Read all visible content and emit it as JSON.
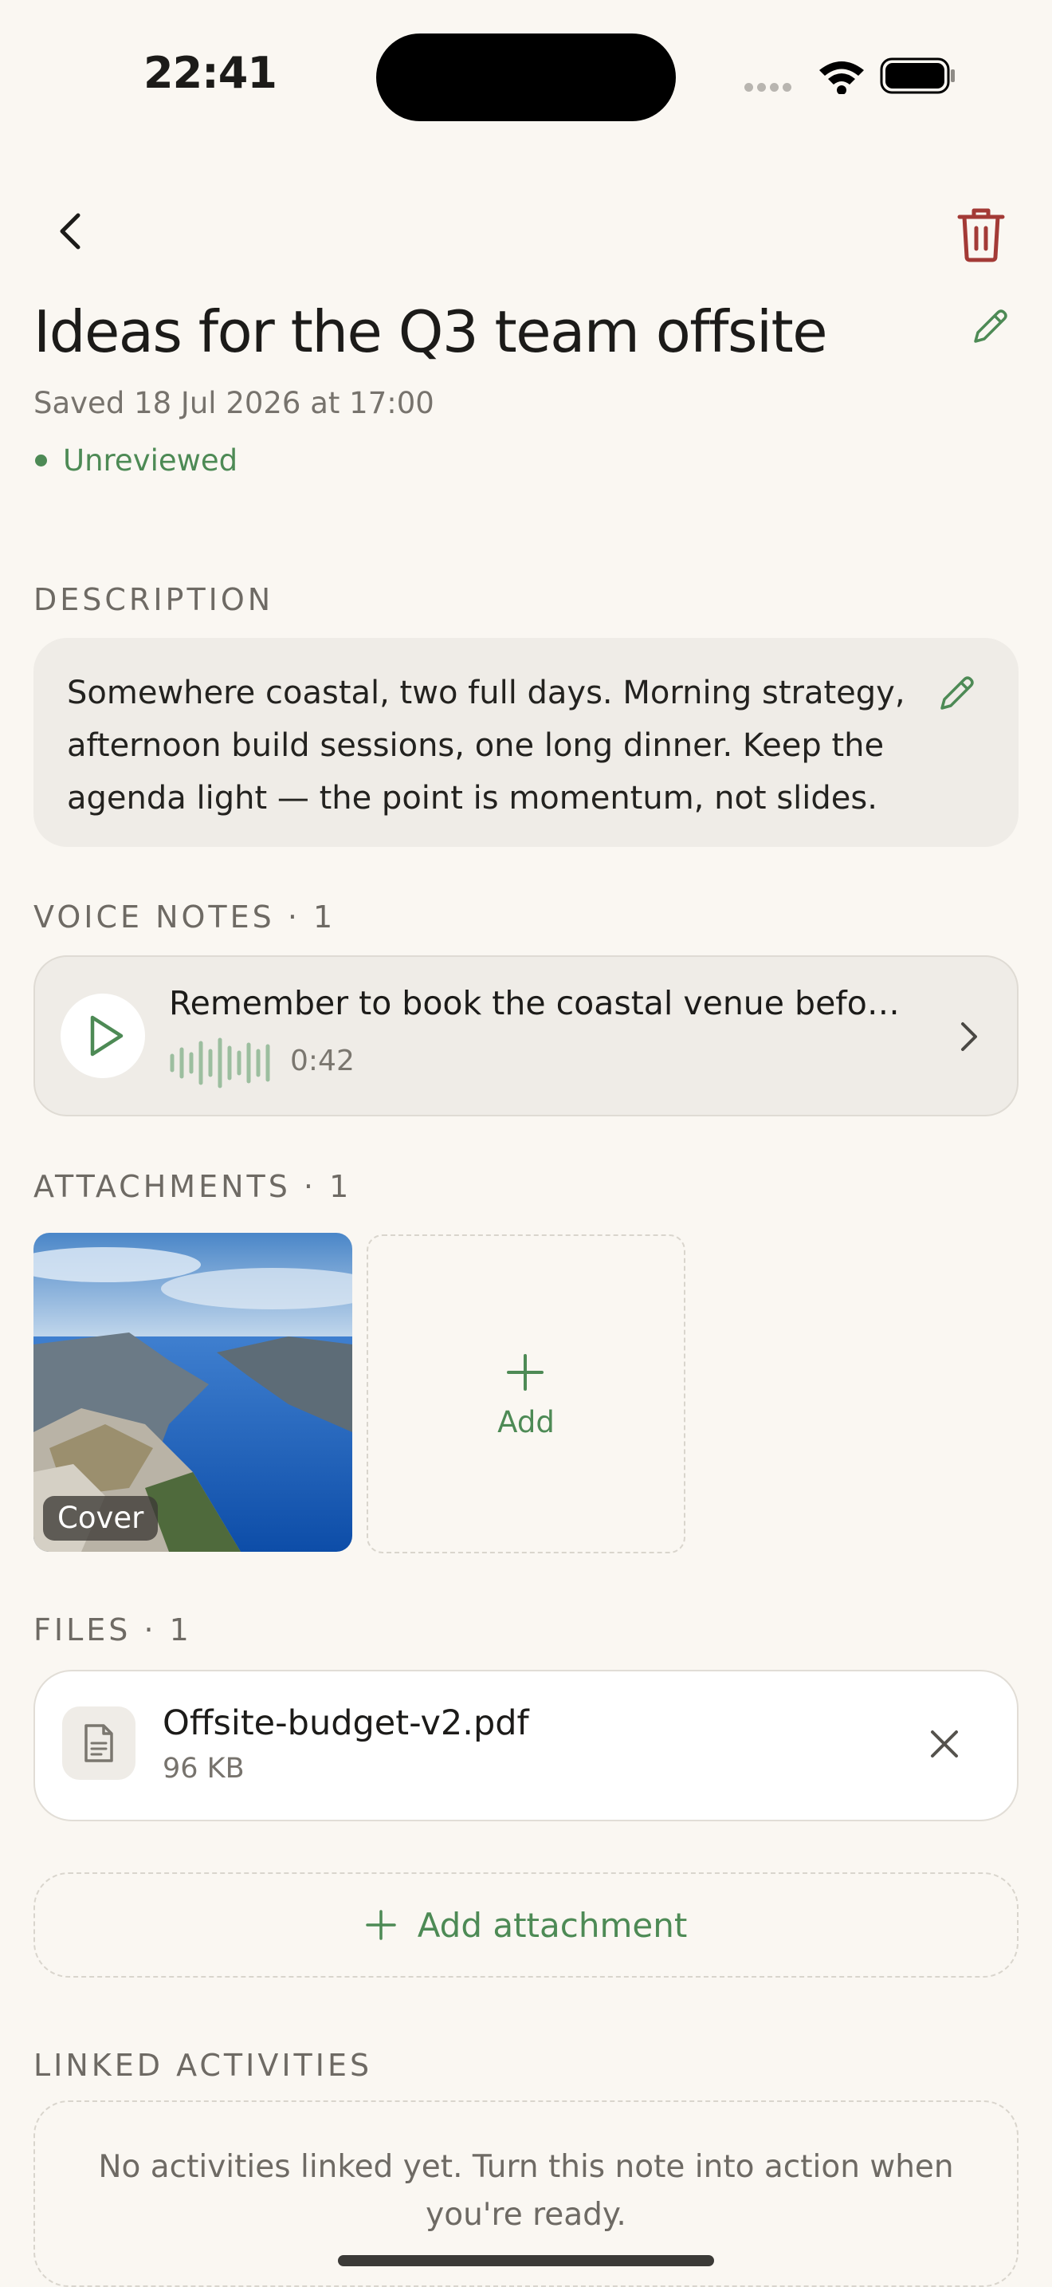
{
  "status": {
    "time": "22:41"
  },
  "header": {
    "back_icon": "chevron-left-icon",
    "delete_icon": "trash-icon"
  },
  "note": {
    "title": "Ideas for the Q3 team offsite",
    "saved": "Saved 18 Jul 2026 at 17:00",
    "review_status": "Unreviewed"
  },
  "description": {
    "label": "DESCRIPTION",
    "text": "Somewhere coastal, two full days. Morning strategy, afternoon build sessions, one long dinner. Keep the agenda light — the point is momentum, not slides."
  },
  "voice_notes": {
    "label": "VOICE NOTES · 1",
    "items": [
      {
        "text": "Remember to book the coastal venue before…",
        "duration": "0:42"
      }
    ]
  },
  "attachments": {
    "label": "ATTACHMENTS · 1",
    "cover_label": "Cover",
    "add_label": "Add"
  },
  "files": {
    "label": "FILES · 1",
    "items": [
      {
        "name": "Offsite-budget-v2.pdf",
        "size": "96 KB"
      }
    ]
  },
  "add_attachment_label": "Add attachment",
  "linked": {
    "label": "LINKED ACTIVITIES",
    "empty_text": "No activities linked yet. Turn this note into action when you're ready."
  },
  "colors": {
    "accent": "#4d8a55",
    "danger": "#a33a36",
    "background": "#faf7f2"
  }
}
